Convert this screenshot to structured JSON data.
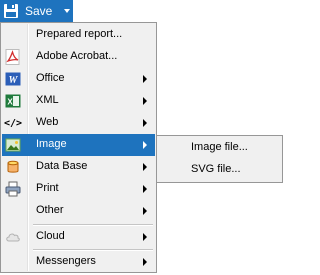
{
  "save_button": {
    "label": "Save",
    "icon": "floppy-disk-icon",
    "color": "#1e73be"
  },
  "menu": {
    "items": [
      {
        "label": "Prepared report...",
        "icon": "none",
        "has_submenu": false
      },
      {
        "label": "Adobe Acrobat...",
        "icon": "pdf-icon",
        "has_submenu": false
      },
      {
        "label": "Office",
        "icon": "word-icon",
        "has_submenu": true
      },
      {
        "label": "XML",
        "icon": "excel-icon",
        "has_submenu": true
      },
      {
        "label": "Web",
        "icon": "html-tag-icon",
        "icon_text": "</>",
        "has_submenu": true
      },
      {
        "label": "Image",
        "icon": "image-icon",
        "has_submenu": true,
        "selected": true
      },
      {
        "label": "Data Base",
        "icon": "database-icon",
        "has_submenu": true
      },
      {
        "label": "Print",
        "icon": "printer-icon",
        "has_submenu": true
      },
      {
        "label": "Other",
        "icon": "none",
        "has_submenu": true
      },
      {
        "label": "Cloud",
        "icon": "cloud-icon",
        "has_submenu": true
      },
      {
        "label": "Messengers",
        "icon": "none",
        "has_submenu": true
      }
    ]
  },
  "submenu": {
    "items": [
      {
        "label": "Image file..."
      },
      {
        "label": "SVG file..."
      }
    ]
  },
  "colors": {
    "highlight": "#1e73be",
    "menu_bg": "#f0f0f0",
    "border": "#979797"
  }
}
